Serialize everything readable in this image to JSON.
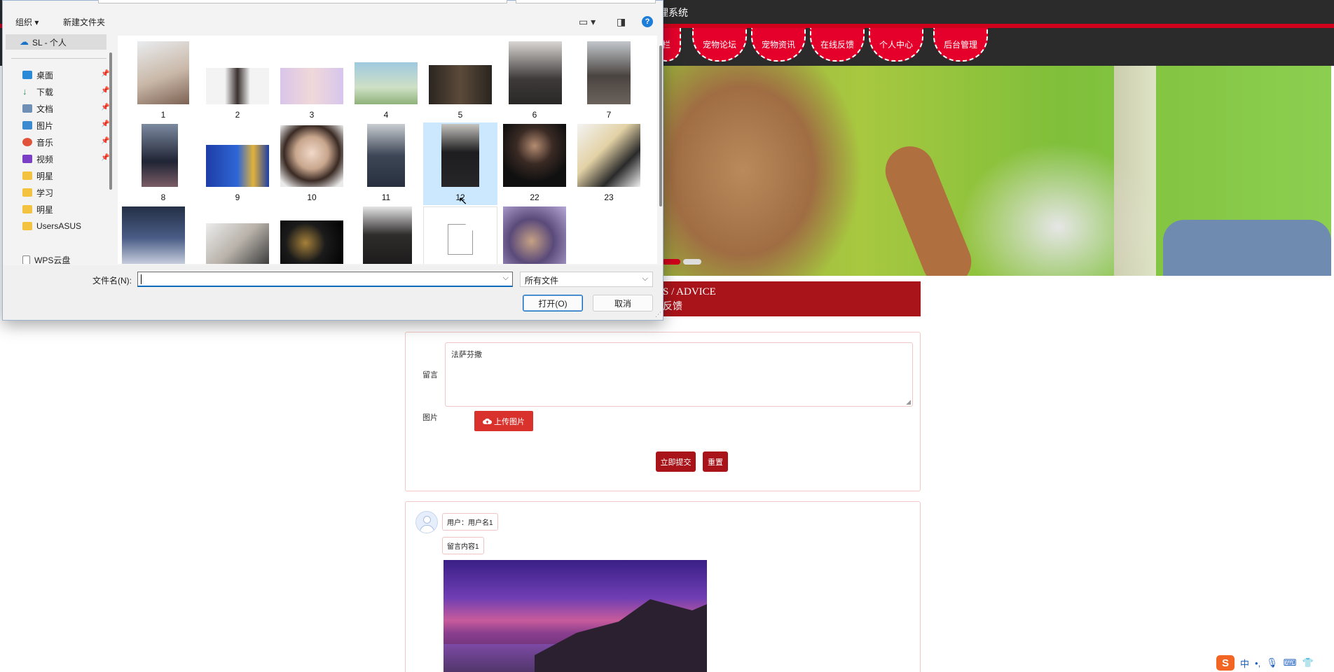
{
  "site": {
    "title": "理系统",
    "nav": [
      "栏",
      "宠物论坛",
      "宠物资讯",
      "在线反馈",
      "个人中心",
      "后台管理"
    ],
    "section_en": "S / ADVICE",
    "section_cn": "反馈",
    "form": {
      "message_label": "留言",
      "message_value": "法萨芬撒",
      "image_label": "图片",
      "upload_label": "上传图片",
      "submit_label": "立即提交",
      "reset_label": "重置"
    },
    "comment": {
      "user_label": "用户：用户名1",
      "content_label": "留言内容1"
    },
    "colors": {
      "brand_red": "#d0021b",
      "dark_red": "#a9141a",
      "header_bg": "#2b2b2b"
    }
  },
  "ime": {
    "logo": "S",
    "lang": "中",
    "punct": "•,",
    "icons": [
      "mic-icon",
      "keyboard-icon",
      "shirt-icon",
      "grid-icon"
    ]
  },
  "dialog": {
    "toolbar": {
      "organize": "组织 ▾",
      "new_folder": "新建文件夹",
      "help": "?"
    },
    "nav": {
      "onedrive": "SL - 个人",
      "quick": [
        {
          "label": "桌面",
          "icon": "desktop-icon",
          "pinned": true
        },
        {
          "label": "下载",
          "icon": "download-icon",
          "pinned": true
        },
        {
          "label": "文档",
          "icon": "document-icon",
          "pinned": true
        },
        {
          "label": "图片",
          "icon": "pictures-icon",
          "pinned": true
        },
        {
          "label": "音乐",
          "icon": "music-icon",
          "pinned": true
        },
        {
          "label": "视频",
          "icon": "video-icon",
          "pinned": true
        },
        {
          "label": "明星",
          "icon": "folder-icon",
          "pinned": false
        },
        {
          "label": "学习",
          "icon": "folder-icon",
          "pinned": false
        },
        {
          "label": "明星",
          "icon": "folder-icon",
          "pinned": false
        },
        {
          "label": "UsersASUS",
          "icon": "folder-icon",
          "pinned": false
        }
      ],
      "wps": "WPS云盘"
    },
    "files": [
      {
        "name": "1"
      },
      {
        "name": "2"
      },
      {
        "name": "3"
      },
      {
        "name": "4"
      },
      {
        "name": "5"
      },
      {
        "name": "6"
      },
      {
        "name": "7"
      },
      {
        "name": "8"
      },
      {
        "name": "9"
      },
      {
        "name": "10"
      },
      {
        "name": "11"
      },
      {
        "name": "12",
        "selected": true
      },
      {
        "name": "22"
      },
      {
        "name": "23"
      },
      {
        "name": ""
      },
      {
        "name": ""
      },
      {
        "name": ""
      },
      {
        "name": ""
      },
      {
        "name": ""
      },
      {
        "name": ""
      }
    ],
    "filename_label": "文件名(N):",
    "filename_value": "",
    "filetype": "所有文件",
    "open_label": "打开(O)",
    "cancel_label": "取消"
  }
}
